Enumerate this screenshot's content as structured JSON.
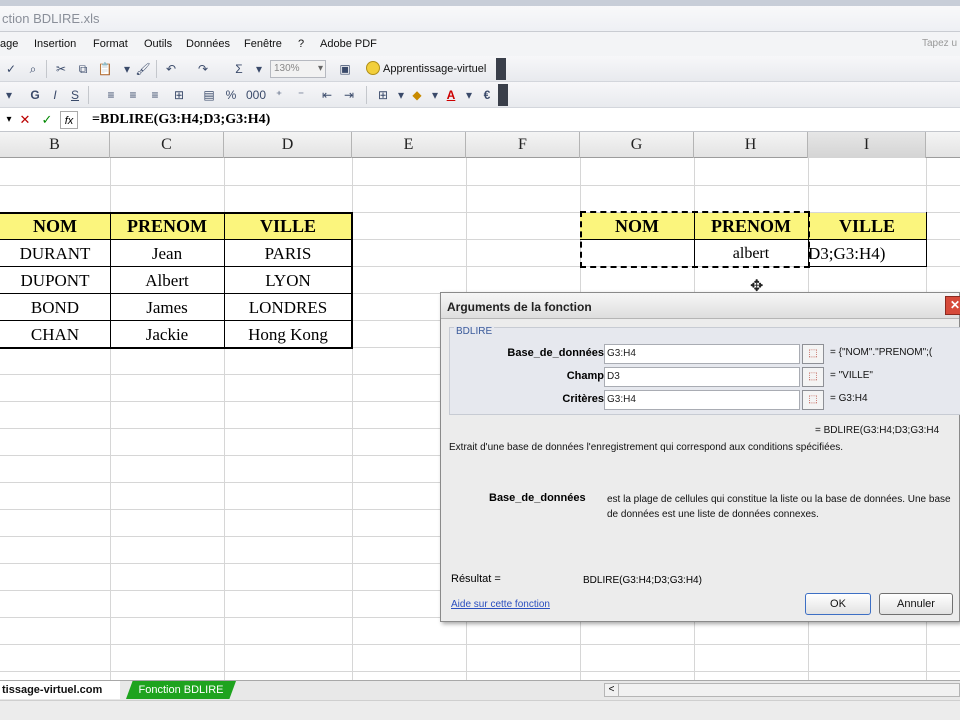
{
  "window": {
    "title": "ction BDLIRE.xls"
  },
  "menu": {
    "items": [
      "age",
      "Insertion",
      "Format",
      "Outils",
      "Données",
      "Fenêtre",
      "?",
      "Adobe PDF"
    ],
    "help_hint": "Tapez u"
  },
  "toolbar": {
    "zoom": "130%",
    "assistant_label": "Apprentissage-virtuel"
  },
  "formula_bar": {
    "formula": "=BDLIRE(G3:H4;D3;G3:H4)"
  },
  "grid": {
    "columns": [
      "B",
      "C",
      "D",
      "E",
      "F",
      "G",
      "H",
      "I"
    ],
    "selected_column": "I",
    "left_table": {
      "headers": [
        "NOM",
        "PRENOM",
        "VILLE"
      ],
      "rows": [
        [
          "DURANT",
          "Jean",
          "PARIS"
        ],
        [
          "DUPONT",
          "Albert",
          "LYON"
        ],
        [
          "BOND",
          "James",
          "LONDRES"
        ],
        [
          "CHAN",
          "Jackie",
          "Hong Kong"
        ]
      ]
    },
    "right_table": {
      "headers": [
        "NOM",
        "PRENOM",
        "VILLE"
      ],
      "row": [
        "",
        "albert",
        "D3;G3:H4)"
      ]
    }
  },
  "sheet_tabs": {
    "active": "tissage-virtuel.com",
    "other": "Fonction BDLIRE"
  },
  "dialog": {
    "title": "Arguments de la fonction",
    "function_name": "BDLIRE",
    "args": [
      {
        "label": "Base_de_données",
        "value": "G3:H4",
        "result": "= {\"NOM\".\"PRENOM\";("
      },
      {
        "label": "Champ",
        "value": "D3",
        "result": "= \"VILLE\""
      },
      {
        "label": "Critères",
        "value": "G3:H4",
        "result": "= G3:H4"
      }
    ],
    "formula_result": "= BDLIRE(G3:H4;D3;G3:H4",
    "description": "Extrait d'une base de données l'enregistrement qui correspond aux conditions spécifiées.",
    "arg_name": "Base_de_données",
    "arg_description": "est la plage de cellules qui constitue la liste ou la base de données. Une base de données est une liste de données connexes.",
    "result_label": "Résultat =",
    "result_value": "BDLIRE(G3:H4;D3;G3:H4)",
    "help_link": "Aide sur cette fonction",
    "ok_label": "OK",
    "cancel_label": "Annuler"
  }
}
